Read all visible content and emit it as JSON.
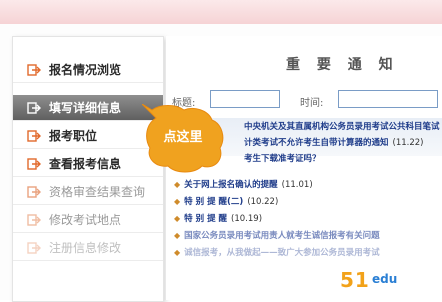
{
  "sidebar": {
    "items": [
      {
        "label": "报名情况浏览"
      },
      {
        "label": "填写详细信息"
      },
      {
        "label": "报考职位"
      },
      {
        "label": "查看报考信息"
      },
      {
        "label": "资格审查结果查询"
      },
      {
        "label": "修改考试地点"
      },
      {
        "label": "注册信息修改"
      }
    ]
  },
  "main": {
    "title": "重 要 通 知",
    "title_label": "标题:",
    "time_label": "时间:",
    "notices": [
      {
        "text": "中央机关及其直属机构公务员录用考试公共科目笔试",
        "date": ""
      },
      {
        "text": "计类考试不允许考生自带计算器的通知",
        "date": "(11.22)"
      },
      {
        "text": "考生下载准考证吗？",
        "date": ""
      },
      {
        "text": "关于网上报名确认的提醒",
        "date": "(11.01)"
      },
      {
        "text": "特 别 提 醒(二)",
        "date": "(10.22)"
      },
      {
        "text": "特 别 提 醒",
        "date": "(10.19)"
      },
      {
        "text": "国家公务员录用考试用责人就考生诚信报考有关问题",
        "date": ""
      },
      {
        "text": "诚信报考，从我做起——致广大参加公务员录用考试",
        "date": ""
      }
    ]
  },
  "callout": {
    "text": "点这里"
  },
  "logo": {
    "text": "51",
    "suffix": "edu"
  },
  "colors": {
    "accent": "#f2a21a",
    "link": "#1f3c8a",
    "bubble": "#f0a21f"
  }
}
